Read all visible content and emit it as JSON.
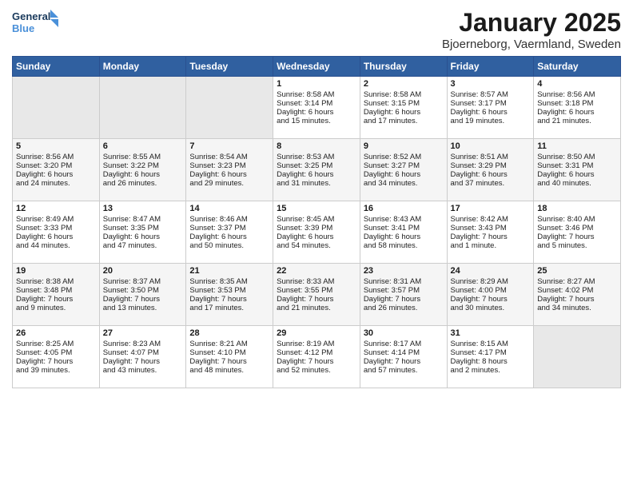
{
  "header": {
    "logo_line1": "General",
    "logo_line2": "Blue",
    "month": "January 2025",
    "location": "Bjoerneborg, Vaermland, Sweden"
  },
  "weekdays": [
    "Sunday",
    "Monday",
    "Tuesday",
    "Wednesday",
    "Thursday",
    "Friday",
    "Saturday"
  ],
  "weeks": [
    [
      {
        "day": "",
        "info": ""
      },
      {
        "day": "",
        "info": ""
      },
      {
        "day": "",
        "info": ""
      },
      {
        "day": "1",
        "info": "Sunrise: 8:58 AM\nSunset: 3:14 PM\nDaylight: 6 hours\nand 15 minutes."
      },
      {
        "day": "2",
        "info": "Sunrise: 8:58 AM\nSunset: 3:15 PM\nDaylight: 6 hours\nand 17 minutes."
      },
      {
        "day": "3",
        "info": "Sunrise: 8:57 AM\nSunset: 3:17 PM\nDaylight: 6 hours\nand 19 minutes."
      },
      {
        "day": "4",
        "info": "Sunrise: 8:56 AM\nSunset: 3:18 PM\nDaylight: 6 hours\nand 21 minutes."
      }
    ],
    [
      {
        "day": "5",
        "info": "Sunrise: 8:56 AM\nSunset: 3:20 PM\nDaylight: 6 hours\nand 24 minutes."
      },
      {
        "day": "6",
        "info": "Sunrise: 8:55 AM\nSunset: 3:22 PM\nDaylight: 6 hours\nand 26 minutes."
      },
      {
        "day": "7",
        "info": "Sunrise: 8:54 AM\nSunset: 3:23 PM\nDaylight: 6 hours\nand 29 minutes."
      },
      {
        "day": "8",
        "info": "Sunrise: 8:53 AM\nSunset: 3:25 PM\nDaylight: 6 hours\nand 31 minutes."
      },
      {
        "day": "9",
        "info": "Sunrise: 8:52 AM\nSunset: 3:27 PM\nDaylight: 6 hours\nand 34 minutes."
      },
      {
        "day": "10",
        "info": "Sunrise: 8:51 AM\nSunset: 3:29 PM\nDaylight: 6 hours\nand 37 minutes."
      },
      {
        "day": "11",
        "info": "Sunrise: 8:50 AM\nSunset: 3:31 PM\nDaylight: 6 hours\nand 40 minutes."
      }
    ],
    [
      {
        "day": "12",
        "info": "Sunrise: 8:49 AM\nSunset: 3:33 PM\nDaylight: 6 hours\nand 44 minutes."
      },
      {
        "day": "13",
        "info": "Sunrise: 8:47 AM\nSunset: 3:35 PM\nDaylight: 6 hours\nand 47 minutes."
      },
      {
        "day": "14",
        "info": "Sunrise: 8:46 AM\nSunset: 3:37 PM\nDaylight: 6 hours\nand 50 minutes."
      },
      {
        "day": "15",
        "info": "Sunrise: 8:45 AM\nSunset: 3:39 PM\nDaylight: 6 hours\nand 54 minutes."
      },
      {
        "day": "16",
        "info": "Sunrise: 8:43 AM\nSunset: 3:41 PM\nDaylight: 6 hours\nand 58 minutes."
      },
      {
        "day": "17",
        "info": "Sunrise: 8:42 AM\nSunset: 3:43 PM\nDaylight: 7 hours\nand 1 minute."
      },
      {
        "day": "18",
        "info": "Sunrise: 8:40 AM\nSunset: 3:46 PM\nDaylight: 7 hours\nand 5 minutes."
      }
    ],
    [
      {
        "day": "19",
        "info": "Sunrise: 8:38 AM\nSunset: 3:48 PM\nDaylight: 7 hours\nand 9 minutes."
      },
      {
        "day": "20",
        "info": "Sunrise: 8:37 AM\nSunset: 3:50 PM\nDaylight: 7 hours\nand 13 minutes."
      },
      {
        "day": "21",
        "info": "Sunrise: 8:35 AM\nSunset: 3:53 PM\nDaylight: 7 hours\nand 17 minutes."
      },
      {
        "day": "22",
        "info": "Sunrise: 8:33 AM\nSunset: 3:55 PM\nDaylight: 7 hours\nand 21 minutes."
      },
      {
        "day": "23",
        "info": "Sunrise: 8:31 AM\nSunset: 3:57 PM\nDaylight: 7 hours\nand 26 minutes."
      },
      {
        "day": "24",
        "info": "Sunrise: 8:29 AM\nSunset: 4:00 PM\nDaylight: 7 hours\nand 30 minutes."
      },
      {
        "day": "25",
        "info": "Sunrise: 8:27 AM\nSunset: 4:02 PM\nDaylight: 7 hours\nand 34 minutes."
      }
    ],
    [
      {
        "day": "26",
        "info": "Sunrise: 8:25 AM\nSunset: 4:05 PM\nDaylight: 7 hours\nand 39 minutes."
      },
      {
        "day": "27",
        "info": "Sunrise: 8:23 AM\nSunset: 4:07 PM\nDaylight: 7 hours\nand 43 minutes."
      },
      {
        "day": "28",
        "info": "Sunrise: 8:21 AM\nSunset: 4:10 PM\nDaylight: 7 hours\nand 48 minutes."
      },
      {
        "day": "29",
        "info": "Sunrise: 8:19 AM\nSunset: 4:12 PM\nDaylight: 7 hours\nand 52 minutes."
      },
      {
        "day": "30",
        "info": "Sunrise: 8:17 AM\nSunset: 4:14 PM\nDaylight: 7 hours\nand 57 minutes."
      },
      {
        "day": "31",
        "info": "Sunrise: 8:15 AM\nSunset: 4:17 PM\nDaylight: 8 hours\nand 2 minutes."
      },
      {
        "day": "",
        "info": ""
      }
    ]
  ]
}
